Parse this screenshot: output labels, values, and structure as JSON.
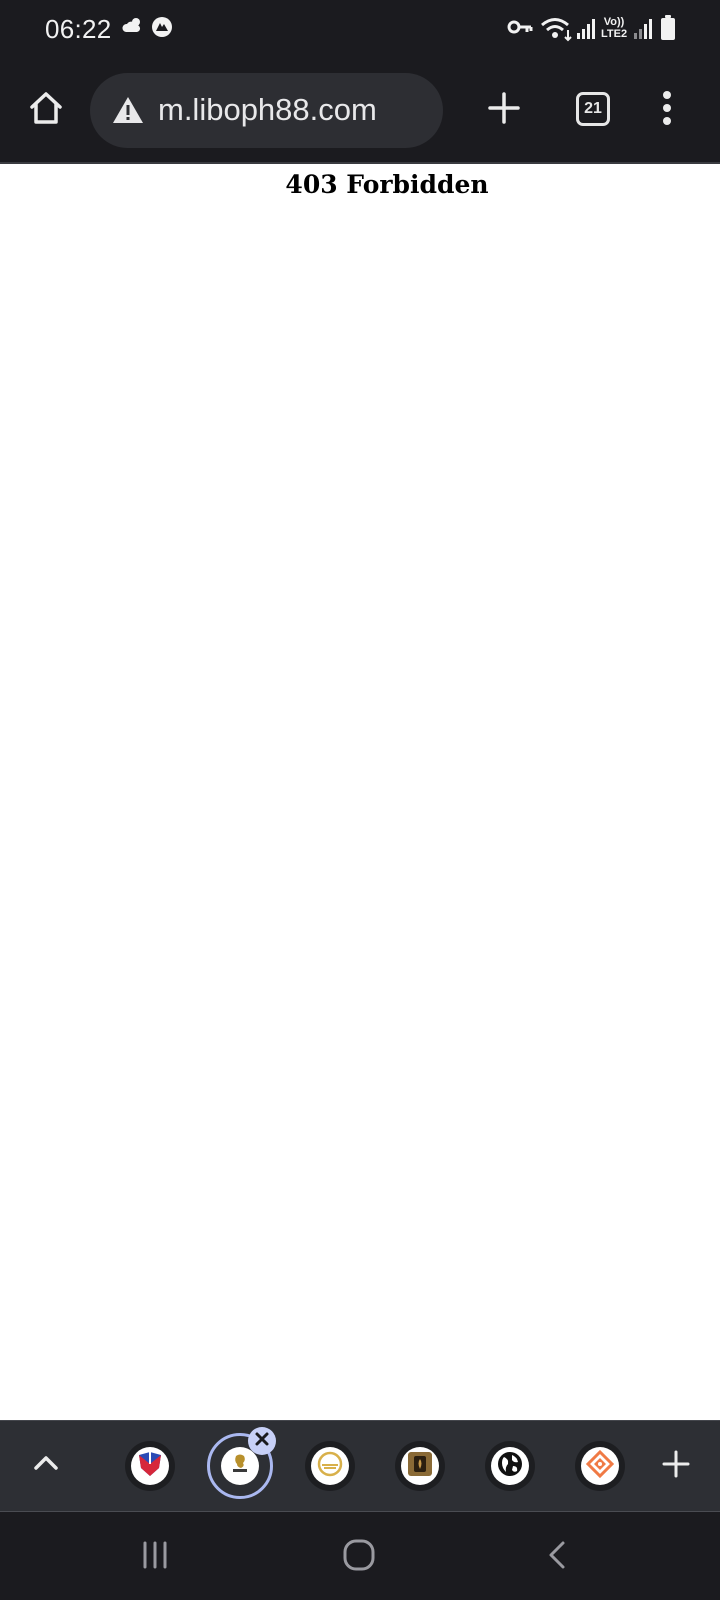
{
  "status_bar": {
    "time": "06:22",
    "notification_icons": [
      "cloud-icon",
      "nordvpn-icon"
    ],
    "right_icons": [
      "vpn-key-icon",
      "wifi-icon",
      "signal-icon",
      "volte-lte2-icon",
      "signal-icon",
      "battery-icon"
    ],
    "volte_label": "Vo))",
    "lte_label": "LTE2"
  },
  "toolbar": {
    "home_icon": "home-icon",
    "url": "m.liboph88.com",
    "security_icon": "warning-icon",
    "new_tab_icon": "plus-icon",
    "tab_count": "21",
    "menu_icon": "more-vert-icon"
  },
  "page": {
    "heading": "403 Forbidden"
  },
  "tab_strip": {
    "collapse_icon": "chevron-up-icon",
    "active_index": 1,
    "tabs": [
      {
        "icon": "shield-favicon"
      },
      {
        "icon": "lion-logo-favicon"
      },
      {
        "icon": "gold-circle-favicon"
      },
      {
        "icon": "bronze-square-favicon"
      },
      {
        "icon": "globe-favicon"
      },
      {
        "icon": "orange-diamond-favicon"
      }
    ],
    "add_icon": "plus-icon",
    "close_icon": "close-icon"
  },
  "nav_bar": {
    "icons": [
      "recent-apps-icon",
      "home-nav-icon",
      "back-icon"
    ]
  },
  "colors": {
    "chrome_bg": "#1b1b1f",
    "omnibox_bg": "#2d2e33",
    "tab_strip_bg": "#2d2f34",
    "active_ring": "#aab8f0",
    "close_badge": "#c7d0f7"
  }
}
